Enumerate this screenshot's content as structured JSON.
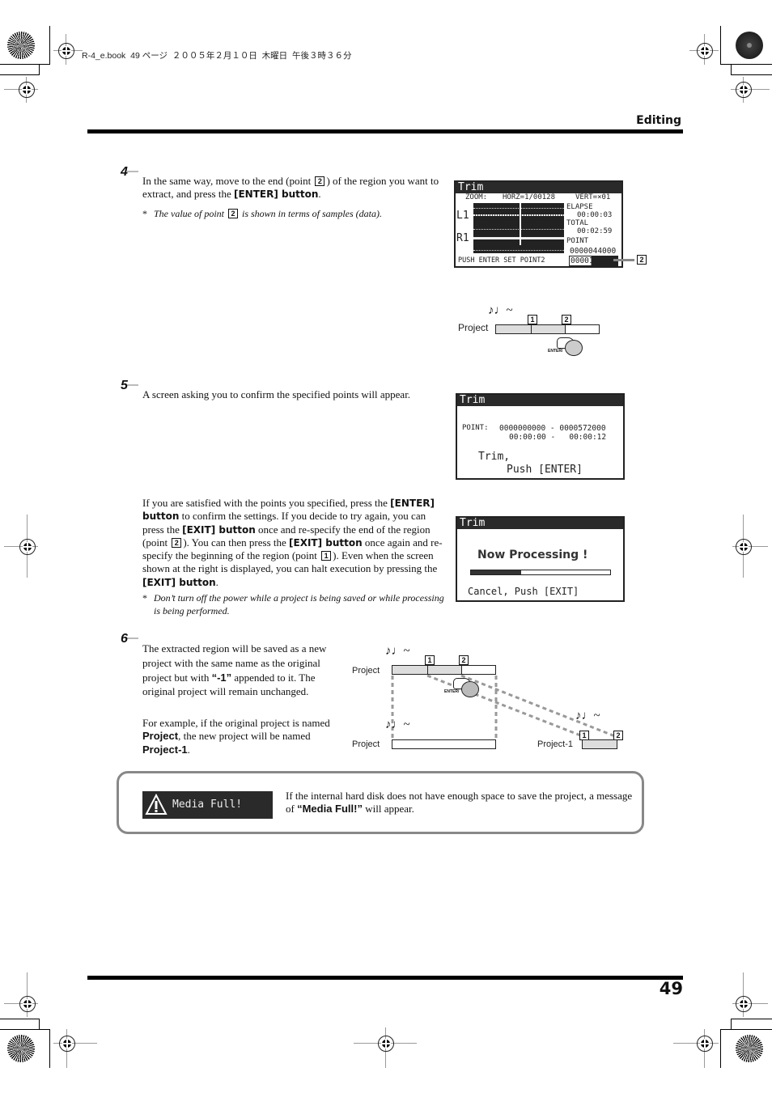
{
  "print_header": {
    "slug": "R-4_e.book  49 ページ  ２００５年２月１０日  木曜日  午後３時３６分"
  },
  "header": {
    "section": "Editing"
  },
  "footer": {
    "page_number": "49"
  },
  "steps": [
    {
      "number": "4",
      "text_pre": "In the same way, move to the end (point ",
      "point_ref": "2",
      "text_mid": ") of the region you want to extract, and press the ",
      "bold": "[ENTER] button",
      "text_post": ".",
      "note_pre": "The value of point ",
      "note_ref": "2",
      "note_post": " is shown in terms of samples (data)."
    },
    {
      "number": "5",
      "text": "A screen asking you to confirm the specified points will appear."
    },
    {
      "number": "6",
      "para1_pre": "The extracted region will be saved as a new project with the same name as the original project but with ",
      "para1_bold": "“-1”",
      "para1_post": " appended to it. The original project will remain unchanged.",
      "para2_pre": "For example, if the original project is named ",
      "para2_bold1": "Project",
      "para2_mid": ", the new project will be named ",
      "para2_bold2": "Project-1",
      "para2_post": "."
    }
  ],
  "confirm_paragraph": {
    "t1": "If you are satisfied with the points you specified, press the ",
    "b1": "[ENTER] button",
    "t2": " to confirm the settings. If you decide to try again, you can press the ",
    "b2": "[EXIT] button",
    "t3": " once and re-specify the end of the region (point ",
    "r1": "2",
    "t4": "). You can then press the ",
    "b3": "[EXIT] button",
    "t5": " once again and re-specify the beginning of the region (point ",
    "r2": "1",
    "t6": "). Even when the screen shown at the right is displayed, you can halt execution by pressing the ",
    "b4": "[EXIT] button",
    "t7": ".",
    "note": "Don’t turn off the power while a project is being saved or while processing is being performed."
  },
  "lcd_trim_wave": {
    "title": "Trim",
    "zoom": "ZOOM:",
    "horz": "HORZ=1/00128",
    "vert": "VERT=×01",
    "ch_l": "L1",
    "ch_r": "R1",
    "elapse_label": "ELAPSE",
    "elapse_value": "00:00:03",
    "total_label": "TOTAL",
    "total_value": "00:02:59",
    "point_label": "POINT",
    "point1_value": "0000044000",
    "point2_value": "0000176000",
    "footer": "PUSH ENTER SET POINT2",
    "callout": "2"
  },
  "lcd_trim_confirm": {
    "title": "Trim",
    "point_label": "POINT:",
    "range_samples": "0000000000 - 0000572000",
    "range_time": "00:00:00 -   00:00:12",
    "line1": "Trim,",
    "line2": "Push [ENTER]"
  },
  "lcd_processing": {
    "title": "Trim",
    "message": "Now Processing !",
    "progress": 0.36,
    "cancel": "Cancel, Push [EXIT]"
  },
  "diagram_step4": {
    "label": "Project",
    "marker1": "1",
    "marker2": "2",
    "button_label": "ENTER/"
  },
  "diagram_step6": {
    "label_top": "Project",
    "label_bottom": "Project",
    "label_new": "Project-1",
    "marker1": "1",
    "marker2": "2",
    "button_label": "ENTER/"
  },
  "media_full_box": {
    "lcd_message": "Media Full!",
    "text_pre": "If the internal hard disk does not have enough space to save the project, a message of ",
    "text_bold": "“Media Full!”",
    "text_post": " will appear."
  }
}
